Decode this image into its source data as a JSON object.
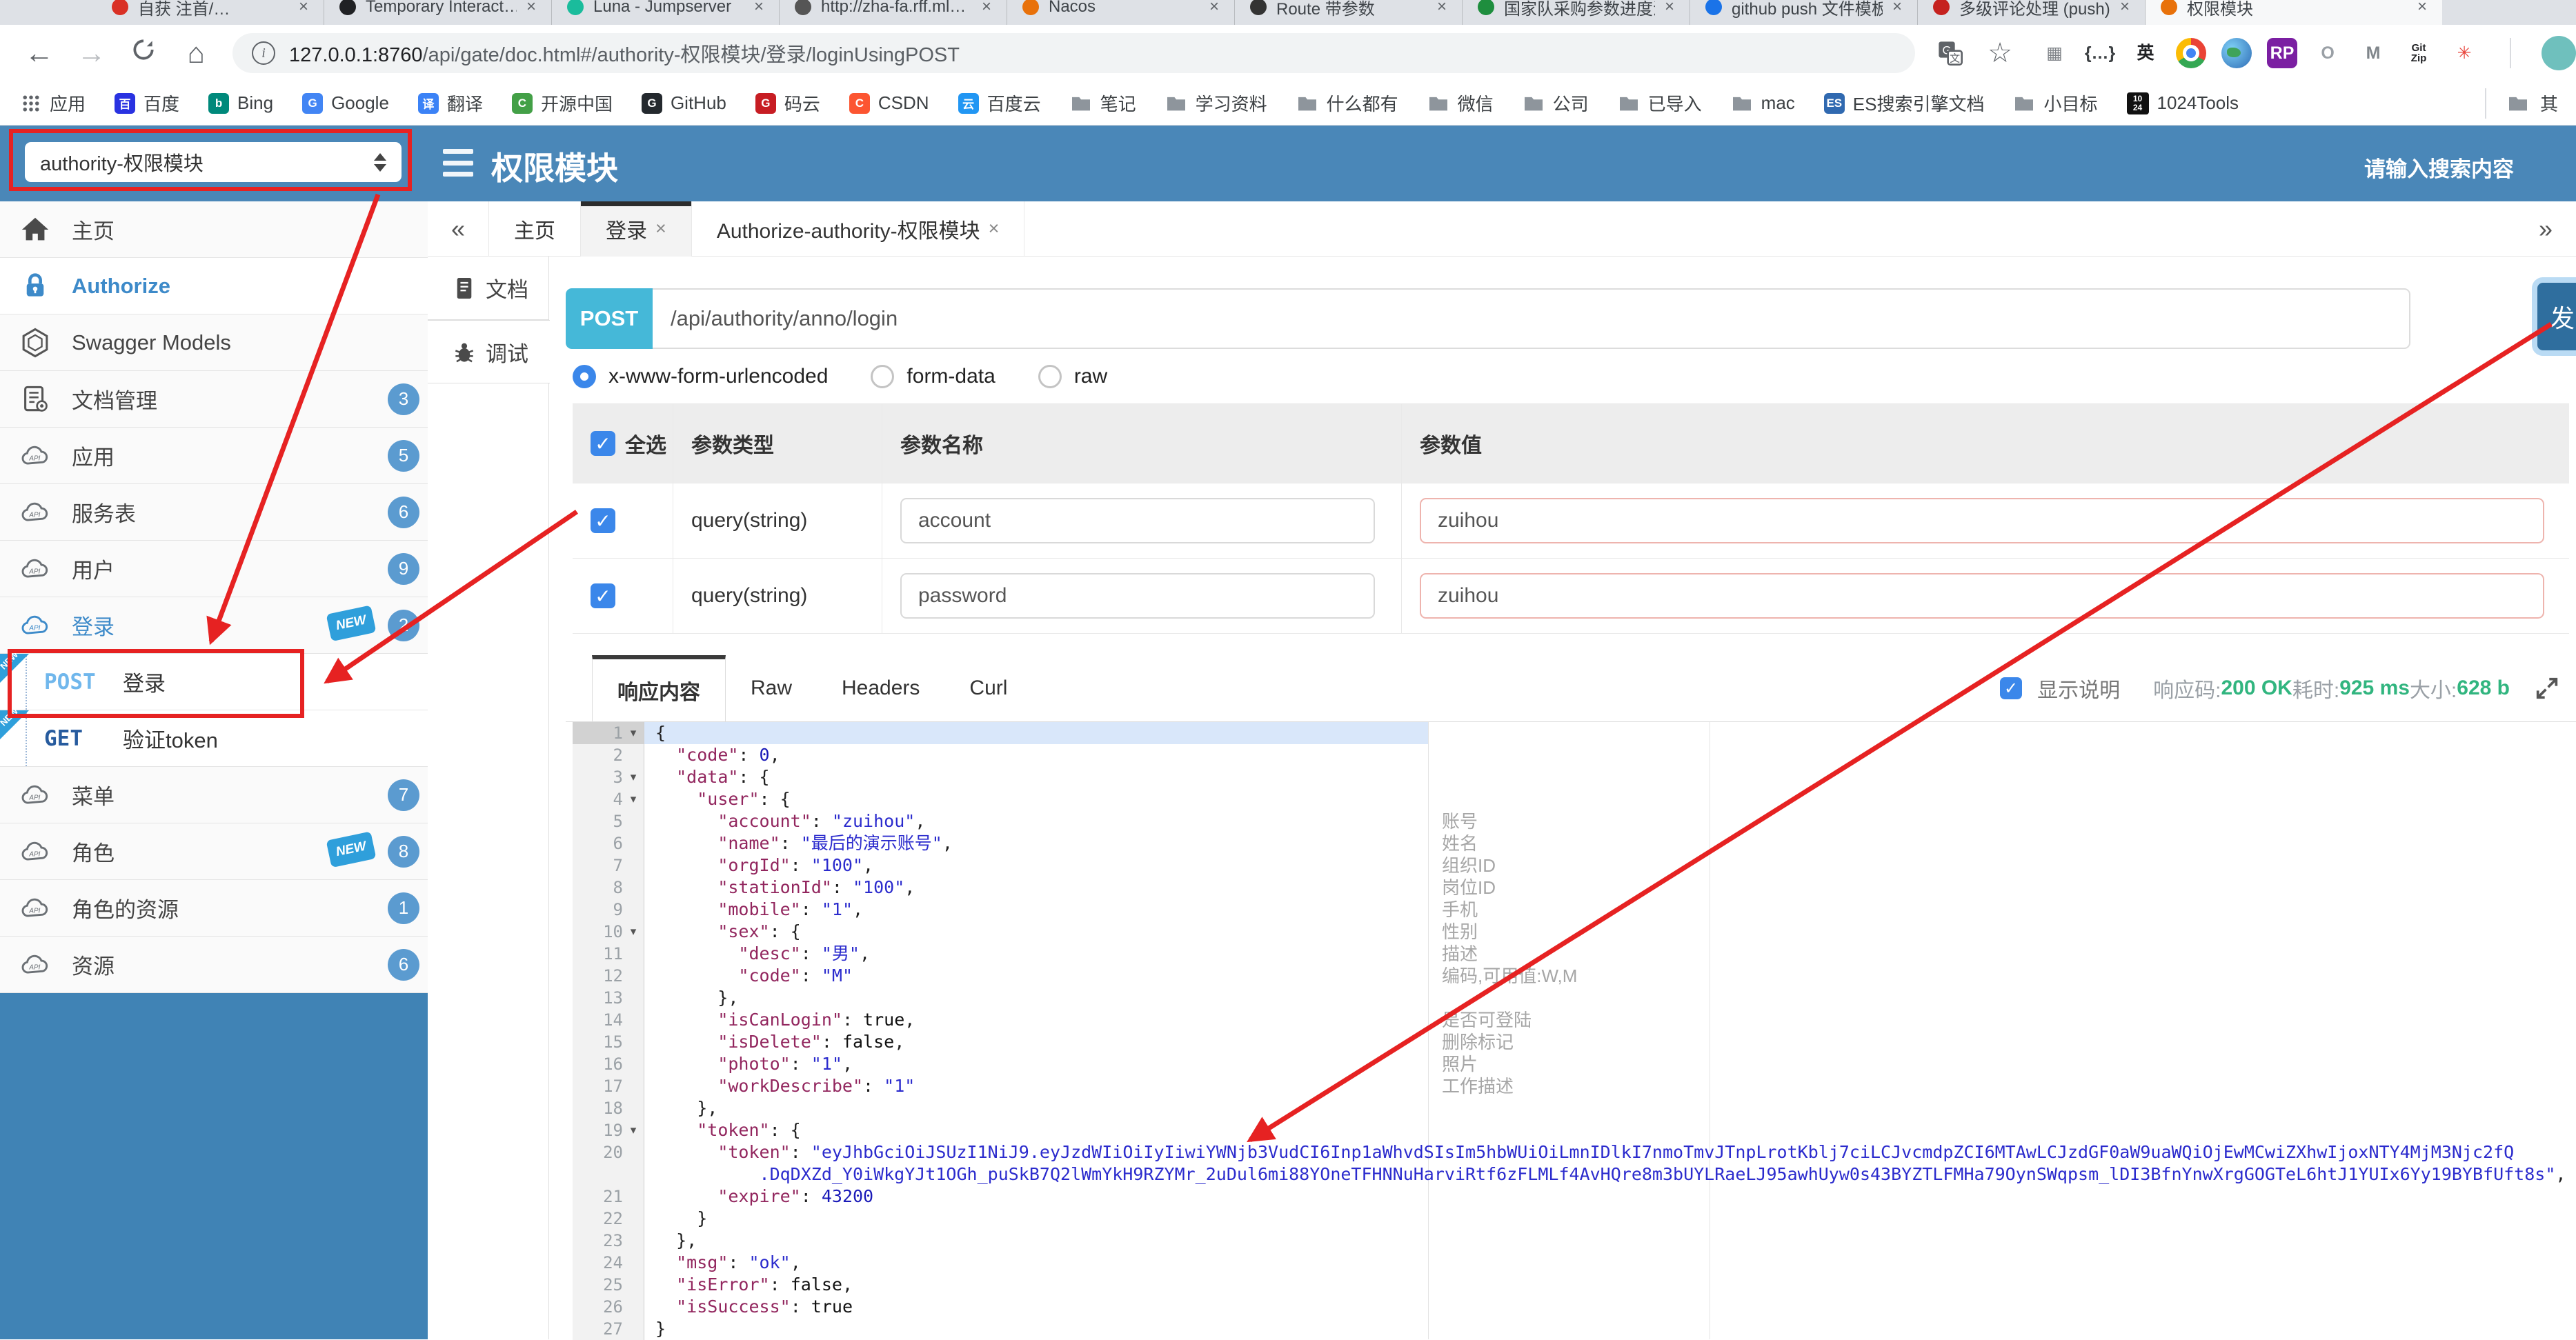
{
  "colors": {
    "header_blue": "#4a87b8",
    "sidebar_blue": "#4083b5",
    "badge_blue": "#5b9bd0",
    "new_badge_blue": "#2f9fdb",
    "post_pill_cyan": "#45b8d8",
    "send_button_blue": "#2f6e9e",
    "status_green": "#31b57f",
    "annotation_red": "#e62222",
    "checkbox_blue": "#3b87ea"
  },
  "browser": {
    "tabs": [
      {
        "label": "自获 注首/…",
        "favicon": "#d93025"
      },
      {
        "label": "Temporary Interact…",
        "favicon": "#202124"
      },
      {
        "label": "Luna - Jumpserver",
        "favicon": "#1abc9c"
      },
      {
        "label": "http://zha-fa.rff.ml…",
        "favicon": "#555"
      },
      {
        "label": "Nacos",
        "favicon": "#e8710a"
      },
      {
        "label": "Route 带参数",
        "favicon": "#333"
      },
      {
        "label": "国家队采购参数进度汇总表",
        "favicon": "#1e8e3e"
      },
      {
        "label": "github push 文件模板",
        "favicon": "#1a73e8"
      },
      {
        "label": "多级评论处理 (push)",
        "favicon": "#c5221f"
      },
      {
        "label": "权限模块",
        "favicon": "#e8710a",
        "active": true
      }
    ],
    "url": {
      "host": "127.0.0.1:8760",
      "path": "/api/gate/doc.html#/authority-权限模块/登录/loginUsingPOST"
    },
    "extensions": [
      {
        "name": "grid-icon",
        "glyph": "▦",
        "color": "#808489"
      },
      {
        "name": "braces-icon",
        "glyph": "{…}",
        "color": "#3c4043"
      },
      {
        "name": "translate-en-icon",
        "glyph": "英",
        "color": "#202124"
      },
      {
        "name": "chrome-icon",
        "glyph": "",
        "color": ""
      },
      {
        "name": "globe-icon",
        "glyph": "",
        "color": ""
      },
      {
        "name": "rp-icon",
        "glyph": "RP",
        "color": "#fff",
        "bg": "#7b1fa2"
      },
      {
        "name": "ring-icon",
        "glyph": "O",
        "color": "#9aa0a6"
      },
      {
        "name": "m-arrow-icon",
        "glyph": "M",
        "color": "#80868b"
      },
      {
        "name": "gitzip-icon",
        "glyph": "Git\nZip",
        "color": "#202124"
      },
      {
        "name": "asterisk-icon",
        "glyph": "✳",
        "color": "#e8453c"
      }
    ],
    "bookmarks": [
      {
        "label": "应用",
        "icon": "apps"
      },
      {
        "label": "百度",
        "icon": "dot",
        "letter": "百",
        "bg": "#2932e1"
      },
      {
        "label": "Bing",
        "icon": "dot",
        "letter": "b",
        "bg": "#00897b"
      },
      {
        "label": "Google",
        "icon": "dot",
        "letter": "G",
        "bg": "#4285f4"
      },
      {
        "label": "翻译",
        "icon": "dot",
        "letter": "译",
        "bg": "#3b82f6"
      },
      {
        "label": "开源中国",
        "icon": "dot",
        "letter": "C",
        "bg": "#43a047"
      },
      {
        "label": "GitHub",
        "icon": "dot",
        "letter": "G",
        "bg": "#24292e"
      },
      {
        "label": "码云",
        "icon": "dot",
        "letter": "G",
        "bg": "#c71d23"
      },
      {
        "label": "CSDN",
        "icon": "dot",
        "letter": "C",
        "bg": "#fc5531"
      },
      {
        "label": "百度云",
        "icon": "dot",
        "letter": "云",
        "bg": "#2196f3"
      },
      {
        "label": "笔记",
        "icon": "folder"
      },
      {
        "label": "学习资料",
        "icon": "folder"
      },
      {
        "label": "什么都有",
        "icon": "folder"
      },
      {
        "label": "微信",
        "icon": "folder"
      },
      {
        "label": "公司",
        "icon": "folder"
      },
      {
        "label": "已导入",
        "icon": "folder"
      },
      {
        "label": "mac",
        "icon": "folder"
      },
      {
        "label": "ES搜索引擎文档",
        "icon": "dot",
        "letter": "ES",
        "bg": "#3069b0"
      },
      {
        "label": "小目标",
        "icon": "folder"
      },
      {
        "label": "1024Tools",
        "icon": "t1024"
      }
    ],
    "bookmarks_overflow": "其"
  },
  "header": {
    "module_select": "authority-权限模块",
    "title": "权限模块",
    "search_placeholder": "请输入搜索内容"
  },
  "sidebar": {
    "items": [
      {
        "type": "item",
        "icon": "home",
        "label": "主页"
      },
      {
        "type": "item",
        "icon": "lock",
        "label": "Authorize",
        "active": true
      },
      {
        "type": "item",
        "icon": "hexagon",
        "label": "Swagger Models"
      },
      {
        "type": "item",
        "icon": "docgear",
        "label": "文档管理",
        "badge": "3"
      },
      {
        "type": "item",
        "icon": "cloud",
        "label": "应用",
        "badge": "5"
      },
      {
        "type": "item",
        "icon": "cloud",
        "label": "服务表",
        "badge": "6"
      },
      {
        "type": "item",
        "icon": "cloud",
        "label": "用户",
        "badge": "9"
      },
      {
        "type": "item",
        "icon": "cloud-blue",
        "label": "登录",
        "badge": "2",
        "sign": true,
        "selected": true
      },
      {
        "type": "child",
        "method": "POST",
        "label": "登录",
        "ribbon": true
      },
      {
        "type": "child",
        "method": "GET",
        "label": "验证token",
        "ribbon": true
      },
      {
        "type": "item",
        "icon": "cloud",
        "label": "菜单",
        "badge": "7"
      },
      {
        "type": "item",
        "icon": "cloud",
        "label": "角色",
        "badge": "8",
        "sign": true
      },
      {
        "type": "item",
        "icon": "cloud",
        "label": "角色的资源",
        "badge": "1"
      },
      {
        "type": "item",
        "icon": "cloud",
        "label": "资源",
        "badge": "6"
      }
    ]
  },
  "workspace": {
    "left_chevron": "«",
    "right_chevron": "»",
    "tabs": [
      {
        "label": "主页"
      },
      {
        "label": "登录",
        "closable": true,
        "active": true
      },
      {
        "label": "Authorize-authority-权限模块",
        "closable": true
      }
    ]
  },
  "doc_panel": {
    "tabs": [
      {
        "label": "文档",
        "icon": "doc"
      },
      {
        "label": "调试",
        "icon": "bug",
        "active": true
      }
    ]
  },
  "request": {
    "method": "POST",
    "path": "/api/authority/anno/login",
    "send_label": "发",
    "body_types": [
      {
        "label": "x-www-form-urlencoded",
        "selected": true
      },
      {
        "label": "form-data",
        "selected": false
      },
      {
        "label": "raw",
        "selected": false
      }
    ]
  },
  "params": {
    "columns": [
      "全选",
      "参数类型",
      "参数名称",
      "参数值"
    ],
    "rows": [
      {
        "checked": true,
        "type": "query(string)",
        "name": "account",
        "value": "zuihou"
      },
      {
        "checked": true,
        "type": "query(string)",
        "name": "password",
        "value": "zuihou"
      }
    ]
  },
  "response": {
    "tabs": [
      {
        "label": "响应内容",
        "active": true
      },
      {
        "label": "Raw"
      },
      {
        "label": "Headers"
      },
      {
        "label": "Curl"
      }
    ],
    "show_desc_label": "显示说明",
    "show_desc_checked": true,
    "meta": [
      {
        "label": "响应码:",
        "value": "200 OK"
      },
      {
        "label": "耗时:",
        "value": "925 ms"
      },
      {
        "label": "大小:",
        "value": "628 b"
      }
    ]
  },
  "editor": {
    "rows": [
      {
        "n": "1",
        "fold": true,
        "hl": true,
        "seg": [
          [
            "pu",
            "{"
          ]
        ]
      },
      {
        "n": "2",
        "seg": [
          [
            "pu",
            "  "
          ],
          [
            "ke",
            "\"code\""
          ],
          [
            "pu",
            ": "
          ],
          [
            "nu",
            "0"
          ],
          [
            "pu",
            ","
          ]
        ]
      },
      {
        "n": "3",
        "fold": true,
        "seg": [
          [
            "pu",
            "  "
          ],
          [
            "ke",
            "\"data\""
          ],
          [
            "pu",
            ": {"
          ]
        ]
      },
      {
        "n": "4",
        "fold": true,
        "seg": [
          [
            "pu",
            "    "
          ],
          [
            "ke",
            "\"user\""
          ],
          [
            "pu",
            ": {"
          ]
        ]
      },
      {
        "n": "5",
        "d": "账号",
        "seg": [
          [
            "pu",
            "      "
          ],
          [
            "ke",
            "\"account\""
          ],
          [
            "pu",
            ": "
          ],
          [
            "st",
            "\"zuihou\""
          ],
          [
            "pu",
            ","
          ]
        ]
      },
      {
        "n": "6",
        "d": "姓名",
        "seg": [
          [
            "pu",
            "      "
          ],
          [
            "ke",
            "\"name\""
          ],
          [
            "pu",
            ": "
          ],
          [
            "st",
            "\"最后的演示账号\""
          ],
          [
            "pu",
            ","
          ]
        ]
      },
      {
        "n": "7",
        "d": "组织ID",
        "seg": [
          [
            "pu",
            "      "
          ],
          [
            "ke",
            "\"orgId\""
          ],
          [
            "pu",
            ": "
          ],
          [
            "st",
            "\"100\""
          ],
          [
            "pu",
            ","
          ]
        ]
      },
      {
        "n": "8",
        "d": "岗位ID",
        "seg": [
          [
            "pu",
            "      "
          ],
          [
            "ke",
            "\"stationId\""
          ],
          [
            "pu",
            ": "
          ],
          [
            "st",
            "\"100\""
          ],
          [
            "pu",
            ","
          ]
        ]
      },
      {
        "n": "9",
        "d": "手机",
        "seg": [
          [
            "pu",
            "      "
          ],
          [
            "ke",
            "\"mobile\""
          ],
          [
            "pu",
            ": "
          ],
          [
            "st",
            "\"1\""
          ],
          [
            "pu",
            ","
          ]
        ]
      },
      {
        "n": "10",
        "d": "性别",
        "fold": true,
        "seg": [
          [
            "pu",
            "      "
          ],
          [
            "ke",
            "\"sex\""
          ],
          [
            "pu",
            ": {"
          ]
        ]
      },
      {
        "n": "11",
        "d": "描述",
        "seg": [
          [
            "pu",
            "        "
          ],
          [
            "ke",
            "\"desc\""
          ],
          [
            "pu",
            ": "
          ],
          [
            "st",
            "\"男\""
          ],
          [
            "pu",
            ","
          ]
        ]
      },
      {
        "n": "12",
        "d": "编码,可用值:W,M",
        "seg": [
          [
            "pu",
            "        "
          ],
          [
            "ke",
            "\"code\""
          ],
          [
            "pu",
            ": "
          ],
          [
            "st",
            "\"M\""
          ]
        ]
      },
      {
        "n": "13",
        "seg": [
          [
            "pu",
            "      },"
          ]
        ]
      },
      {
        "n": "14",
        "d": "是否可登陆",
        "seg": [
          [
            "pu",
            "      "
          ],
          [
            "ke",
            "\"isCanLogin\""
          ],
          [
            "pu",
            ": "
          ],
          [
            "bo",
            "true"
          ],
          [
            "pu",
            ","
          ]
        ]
      },
      {
        "n": "15",
        "d": "删除标记",
        "seg": [
          [
            "pu",
            "      "
          ],
          [
            "ke",
            "\"isDelete\""
          ],
          [
            "pu",
            ": "
          ],
          [
            "bo",
            "false"
          ],
          [
            "pu",
            ","
          ]
        ]
      },
      {
        "n": "16",
        "d": "照片",
        "seg": [
          [
            "pu",
            "      "
          ],
          [
            "ke",
            "\"photo\""
          ],
          [
            "pu",
            ": "
          ],
          [
            "st",
            "\"1\""
          ],
          [
            "pu",
            ","
          ]
        ]
      },
      {
        "n": "17",
        "d": "工作描述",
        "seg": [
          [
            "pu",
            "      "
          ],
          [
            "ke",
            "\"workDescribe\""
          ],
          [
            "pu",
            ": "
          ],
          [
            "st",
            "\"1\""
          ]
        ]
      },
      {
        "n": "18",
        "seg": [
          [
            "pu",
            "    },"
          ]
        ]
      },
      {
        "n": "19",
        "fold": true,
        "seg": [
          [
            "pu",
            "    "
          ],
          [
            "ke",
            "\"token\""
          ],
          [
            "pu",
            ": {"
          ]
        ]
      },
      {
        "n": "20",
        "seg": [
          [
            "pu",
            "      "
          ],
          [
            "ke",
            "\"token\""
          ],
          [
            "pu",
            ": "
          ],
          [
            "st",
            "\"eyJhbGciOiJSUzI1NiJ9.eyJzdWIiOiIyIiwiYWNjb3VudCI6Inp1aWhvdSIsIm5hbWUiOiLmnIDlkI7nmoTmvJTnpLrotKblj7ciLCJvcmdpZCI6MTAwLCJzdGF0aW9uaWQiOjEwMCwiZXhwIjoxNTY4MjM3Njc2fQ"
          ]
        ]
      },
      {
        "n": "",
        "seg": [
          [
            "st",
            "          .DqDXZd_Y0iWkgYJt1OGh_puSkB7Q2lWmYkH9RZYMr_2uDul6mi88YOneTFHNNuHarviRtf6zFLMLf4AvHQre8m3bUYLRaeLJ95awhUyw0s43BYZTLFMHa79OynSWqpsm_lDI3BfnYnwXrgGOGTeL6htJ1YUIx6Yy19BYBfUft8s\""
          ],
          [
            "pu",
            ","
          ]
        ]
      },
      {
        "n": "21",
        "seg": [
          [
            "pu",
            "      "
          ],
          [
            "ke",
            "\"expire\""
          ],
          [
            "pu",
            ": "
          ],
          [
            "nu",
            "43200"
          ]
        ]
      },
      {
        "n": "22",
        "seg": [
          [
            "pu",
            "    }"
          ]
        ]
      },
      {
        "n": "23",
        "seg": [
          [
            "pu",
            "  },"
          ]
        ]
      },
      {
        "n": "24",
        "seg": [
          [
            "pu",
            "  "
          ],
          [
            "ke",
            "\"msg\""
          ],
          [
            "pu",
            ": "
          ],
          [
            "st",
            "\"ok\""
          ],
          [
            "pu",
            ","
          ]
        ]
      },
      {
        "n": "25",
        "seg": [
          [
            "pu",
            "  "
          ],
          [
            "ke",
            "\"isError\""
          ],
          [
            "pu",
            ": "
          ],
          [
            "bo",
            "false"
          ],
          [
            "pu",
            ","
          ]
        ]
      },
      {
        "n": "26",
        "seg": [
          [
            "pu",
            "  "
          ],
          [
            "ke",
            "\"isSuccess\""
          ],
          [
            "pu",
            ": "
          ],
          [
            "bo",
            "true"
          ]
        ]
      },
      {
        "n": "27",
        "seg": [
          [
            "pu",
            "}"
          ]
        ]
      }
    ]
  }
}
